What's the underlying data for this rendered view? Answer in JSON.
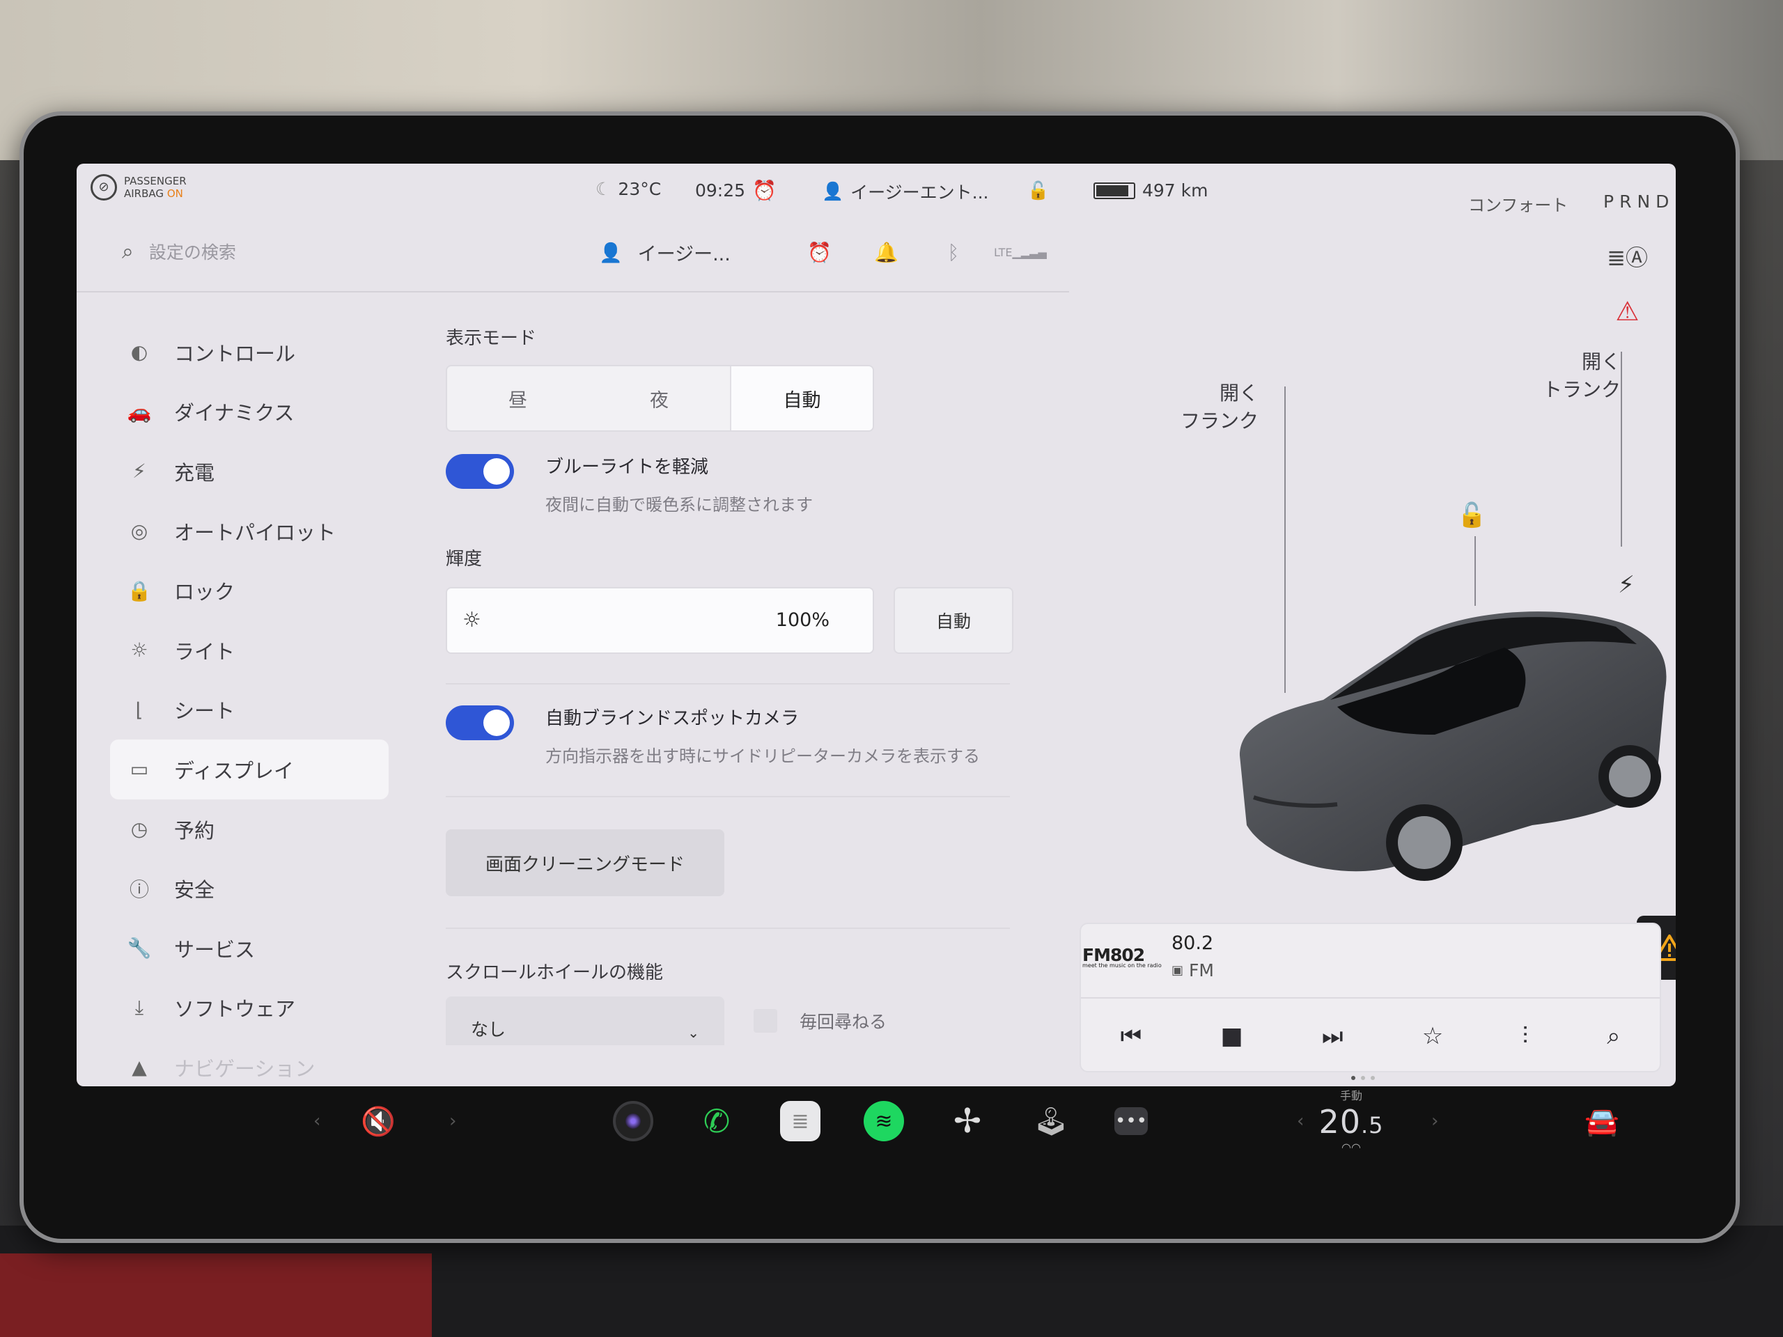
{
  "status_bar": {
    "airbag_line1": "PASSENGER",
    "airbag_line2": "AIRBAG",
    "airbag_state": "ON",
    "temperature": "23°C",
    "time": "09:25",
    "driver_profile": "イージーエント...",
    "range": "497 km",
    "battery_level_fraction": 0.9,
    "drive_mode": "コンフォート",
    "gears": "PRND"
  },
  "settings_header": {
    "search_placeholder": "設定の検索",
    "profile_name": "イージー..."
  },
  "sidebar": {
    "items": [
      {
        "label": "コントロール",
        "icon": "toggle-icon"
      },
      {
        "label": "ダイナミクス",
        "icon": "car-icon"
      },
      {
        "label": "充電",
        "icon": "lightning-icon"
      },
      {
        "label": "オートパイロット",
        "icon": "steering-wheel-icon"
      },
      {
        "label": "ロック",
        "icon": "lock-icon"
      },
      {
        "label": "ライト",
        "icon": "light-icon"
      },
      {
        "label": "シート",
        "icon": "seat-icon"
      },
      {
        "label": "ディスプレイ",
        "icon": "display-icon",
        "active": true
      },
      {
        "label": "予約",
        "icon": "schedule-icon"
      },
      {
        "label": "安全",
        "icon": "safety-icon"
      },
      {
        "label": "サービス",
        "icon": "wrench-icon"
      },
      {
        "label": "ソフトウェア",
        "icon": "download-icon"
      },
      {
        "label": "ナビゲーション",
        "icon": "navigation-icon"
      }
    ]
  },
  "display_settings": {
    "mode_label": "表示モード",
    "modes": [
      "昼",
      "夜",
      "自動"
    ],
    "selected_mode": "自動",
    "blue_light": {
      "title": "ブルーライトを軽減",
      "subtitle": "夜間に自動で暖色系に調整されます",
      "enabled": true
    },
    "brightness": {
      "label": "輝度",
      "value": "100%",
      "level_fraction": 1.0,
      "auto_label": "自動"
    },
    "blind_spot": {
      "title": "自動ブラインドスポットカメラ",
      "subtitle": "方向指示器を出す時にサイドリピーターカメラを表示する",
      "enabled": true
    },
    "cleaning_mode_button": "画面クリーニングモード",
    "scroll_wheel": {
      "label": "スクロールホイールの機能",
      "selected": "なし",
      "ask_each_time": "毎回尋ねる"
    }
  },
  "car_panel": {
    "frunk_action": "開く",
    "frunk_label": "フランク",
    "trunk_action": "開く",
    "trunk_label": "トランク",
    "body_color": "#4b4d52"
  },
  "media": {
    "station_logo": "FM802",
    "station_tagline": "meet the music on the radio",
    "frequency": "80.2",
    "band": "FM"
  },
  "dock": {
    "climate_mode": "手動",
    "cabin_temp_whole": "20",
    "cabin_temp_decimal": ".5"
  },
  "colors": {
    "accent": "#2f56d6",
    "alert_orange": "#e8801a",
    "seatbelt_red": "#d9323a",
    "spotify_green": "#1ed760"
  }
}
